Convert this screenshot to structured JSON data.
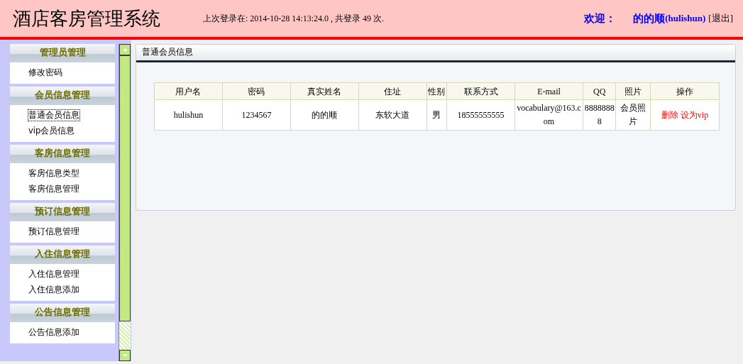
{
  "header": {
    "title": "酒店客房管理系统",
    "last_login": "上次登录在: 2014-10-28 14:13:24.0 , 共登录  49 次.",
    "welcome": "欢迎：",
    "user": "的的顺",
    "username": "(hulishun)",
    "logout": "[退出]"
  },
  "sidebar": {
    "sections": [
      {
        "title": "管理员管理",
        "items": [
          {
            "label": "修改密码",
            "selected": false
          }
        ]
      },
      {
        "title": "会员信息管理",
        "items": [
          {
            "label": "普通会员信息",
            "selected": true
          },
          {
            "label": "vip会员信息",
            "selected": false
          }
        ]
      },
      {
        "title": "客房信息管理",
        "items": [
          {
            "label": "客房信息类型",
            "selected": false
          },
          {
            "label": "客房信息管理",
            "selected": false
          }
        ]
      },
      {
        "title": "预订信息管理",
        "items": [
          {
            "label": "预订信息管理",
            "selected": false
          }
        ]
      },
      {
        "title": "入住信息管理",
        "items": [
          {
            "label": "入住信息管理",
            "selected": false
          },
          {
            "label": "入住信息添加",
            "selected": false
          }
        ]
      },
      {
        "title": "公告信息管理",
        "items": [
          {
            "label": "公告信息添加",
            "selected": false
          }
        ]
      }
    ]
  },
  "panel": {
    "title": "普通会员信息",
    "table": {
      "columns": [
        "用户名",
        "密码",
        "真实姓名",
        "住址",
        "性别",
        "联系方式",
        "E-mail",
        "QQ",
        "照片",
        "操作"
      ],
      "rows": [
        {
          "cells": [
            "hulishun",
            "1234567",
            "的的顺",
            "东软大道",
            "男",
            "18555555555",
            "vocabulary@163.com",
            "88888888",
            "会员照片"
          ],
          "actions": [
            "删除",
            "设为vip"
          ]
        }
      ]
    }
  }
}
